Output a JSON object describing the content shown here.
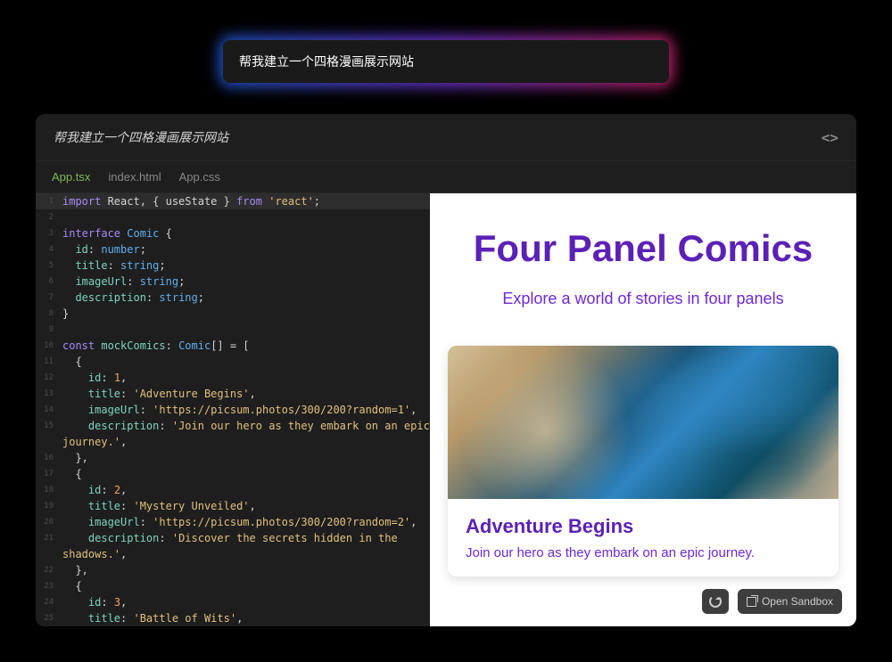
{
  "prompt": {
    "text": "帮我建立一个四格漫画展示网站"
  },
  "panel": {
    "title": "帮我建立一个四格漫画展示网站",
    "tabs": [
      "App.tsx",
      "index.html",
      "App.css"
    ],
    "active_tab": 0
  },
  "code": {
    "lines": [
      {
        "n": 1,
        "hl": true,
        "t": [
          {
            "c": "kw",
            "s": "import"
          },
          {
            "c": "pl",
            "s": " React, { useState } "
          },
          {
            "c": "kw",
            "s": "from"
          },
          {
            "c": "pl",
            "s": " "
          },
          {
            "c": "str",
            "s": "'react'"
          },
          {
            "c": "pl",
            "s": ";"
          }
        ]
      },
      {
        "n": 2,
        "t": []
      },
      {
        "n": 3,
        "t": [
          {
            "c": "kw",
            "s": "interface"
          },
          {
            "c": "pl",
            "s": " "
          },
          {
            "c": "fn",
            "s": "Comic"
          },
          {
            "c": "pl",
            "s": " {"
          }
        ]
      },
      {
        "n": 4,
        "t": [
          {
            "c": "pl",
            "s": "  "
          },
          {
            "c": "prop",
            "s": "id"
          },
          {
            "c": "pl",
            "s": ": "
          },
          {
            "c": "fn",
            "s": "number"
          },
          {
            "c": "pl",
            "s": ";"
          }
        ]
      },
      {
        "n": 5,
        "t": [
          {
            "c": "pl",
            "s": "  "
          },
          {
            "c": "prop",
            "s": "title"
          },
          {
            "c": "pl",
            "s": ": "
          },
          {
            "c": "fn",
            "s": "string"
          },
          {
            "c": "pl",
            "s": ";"
          }
        ]
      },
      {
        "n": 6,
        "t": [
          {
            "c": "pl",
            "s": "  "
          },
          {
            "c": "prop",
            "s": "imageUrl"
          },
          {
            "c": "pl",
            "s": ": "
          },
          {
            "c": "fn",
            "s": "string"
          },
          {
            "c": "pl",
            "s": ";"
          }
        ]
      },
      {
        "n": 7,
        "t": [
          {
            "c": "pl",
            "s": "  "
          },
          {
            "c": "prop",
            "s": "description"
          },
          {
            "c": "pl",
            "s": ": "
          },
          {
            "c": "fn",
            "s": "string"
          },
          {
            "c": "pl",
            "s": ";"
          }
        ]
      },
      {
        "n": 8,
        "t": [
          {
            "c": "pl",
            "s": "}"
          }
        ]
      },
      {
        "n": 9,
        "t": []
      },
      {
        "n": 10,
        "t": [
          {
            "c": "kw",
            "s": "const"
          },
          {
            "c": "pl",
            "s": " "
          },
          {
            "c": "prop",
            "s": "mockComics"
          },
          {
            "c": "pl",
            "s": ": "
          },
          {
            "c": "fn",
            "s": "Comic"
          },
          {
            "c": "pl",
            "s": "[] = ["
          }
        ]
      },
      {
        "n": 11,
        "t": [
          {
            "c": "pl",
            "s": "  {"
          }
        ]
      },
      {
        "n": 12,
        "t": [
          {
            "c": "pl",
            "s": "    "
          },
          {
            "c": "prop",
            "s": "id"
          },
          {
            "c": "pl",
            "s": ": "
          },
          {
            "c": "num",
            "s": "1"
          },
          {
            "c": "pl",
            "s": ","
          }
        ]
      },
      {
        "n": 13,
        "t": [
          {
            "c": "pl",
            "s": "    "
          },
          {
            "c": "prop",
            "s": "title"
          },
          {
            "c": "pl",
            "s": ": "
          },
          {
            "c": "str",
            "s": "'Adventure Begins'"
          },
          {
            "c": "pl",
            "s": ","
          }
        ]
      },
      {
        "n": 14,
        "t": [
          {
            "c": "pl",
            "s": "    "
          },
          {
            "c": "prop",
            "s": "imageUrl"
          },
          {
            "c": "pl",
            "s": ": "
          },
          {
            "c": "str",
            "s": "'https://picsum.photos/300/200?random=1'"
          },
          {
            "c": "pl",
            "s": ","
          }
        ]
      },
      {
        "n": 15,
        "t": [
          {
            "c": "pl",
            "s": "    "
          },
          {
            "c": "prop",
            "s": "description"
          },
          {
            "c": "pl",
            "s": ": "
          },
          {
            "c": "str",
            "s": "'Join our hero as they embark on an epic "
          }
        ]
      },
      {
        "n": "",
        "t": [
          {
            "c": "str",
            "s": "journey.'"
          },
          {
            "c": "pl",
            "s": ","
          }
        ]
      },
      {
        "n": 16,
        "t": [
          {
            "c": "pl",
            "s": "  },"
          }
        ]
      },
      {
        "n": 17,
        "t": [
          {
            "c": "pl",
            "s": "  {"
          }
        ]
      },
      {
        "n": 18,
        "t": [
          {
            "c": "pl",
            "s": "    "
          },
          {
            "c": "prop",
            "s": "id"
          },
          {
            "c": "pl",
            "s": ": "
          },
          {
            "c": "num",
            "s": "2"
          },
          {
            "c": "pl",
            "s": ","
          }
        ]
      },
      {
        "n": 19,
        "t": [
          {
            "c": "pl",
            "s": "    "
          },
          {
            "c": "prop",
            "s": "title"
          },
          {
            "c": "pl",
            "s": ": "
          },
          {
            "c": "str",
            "s": "'Mystery Unveiled'"
          },
          {
            "c": "pl",
            "s": ","
          }
        ]
      },
      {
        "n": 20,
        "t": [
          {
            "c": "pl",
            "s": "    "
          },
          {
            "c": "prop",
            "s": "imageUrl"
          },
          {
            "c": "pl",
            "s": ": "
          },
          {
            "c": "str",
            "s": "'https://picsum.photos/300/200?random=2'"
          },
          {
            "c": "pl",
            "s": ","
          }
        ]
      },
      {
        "n": 21,
        "t": [
          {
            "c": "pl",
            "s": "    "
          },
          {
            "c": "prop",
            "s": "description"
          },
          {
            "c": "pl",
            "s": ": "
          },
          {
            "c": "str",
            "s": "'Discover the secrets hidden in the "
          }
        ]
      },
      {
        "n": "",
        "t": [
          {
            "c": "str",
            "s": "shadows.'"
          },
          {
            "c": "pl",
            "s": ","
          }
        ]
      },
      {
        "n": 22,
        "t": [
          {
            "c": "pl",
            "s": "  },"
          }
        ]
      },
      {
        "n": 23,
        "t": [
          {
            "c": "pl",
            "s": "  {"
          }
        ]
      },
      {
        "n": 24,
        "t": [
          {
            "c": "pl",
            "s": "    "
          },
          {
            "c": "prop",
            "s": "id"
          },
          {
            "c": "pl",
            "s": ": "
          },
          {
            "c": "num",
            "s": "3"
          },
          {
            "c": "pl",
            "s": ","
          }
        ]
      },
      {
        "n": 25,
        "t": [
          {
            "c": "pl",
            "s": "    "
          },
          {
            "c": "prop",
            "s": "title"
          },
          {
            "c": "pl",
            "s": ": "
          },
          {
            "c": "str",
            "s": "'Battle of Wits'"
          },
          {
            "c": "pl",
            "s": ","
          }
        ]
      }
    ]
  },
  "preview": {
    "title": "Four Panel Comics",
    "subtitle": "Explore a world of stories in four panels",
    "card": {
      "title": "Adventure Begins",
      "desc": "Join our hero as they embark on an epic journey."
    }
  },
  "buttons": {
    "sandbox": "Open Sandbox"
  }
}
